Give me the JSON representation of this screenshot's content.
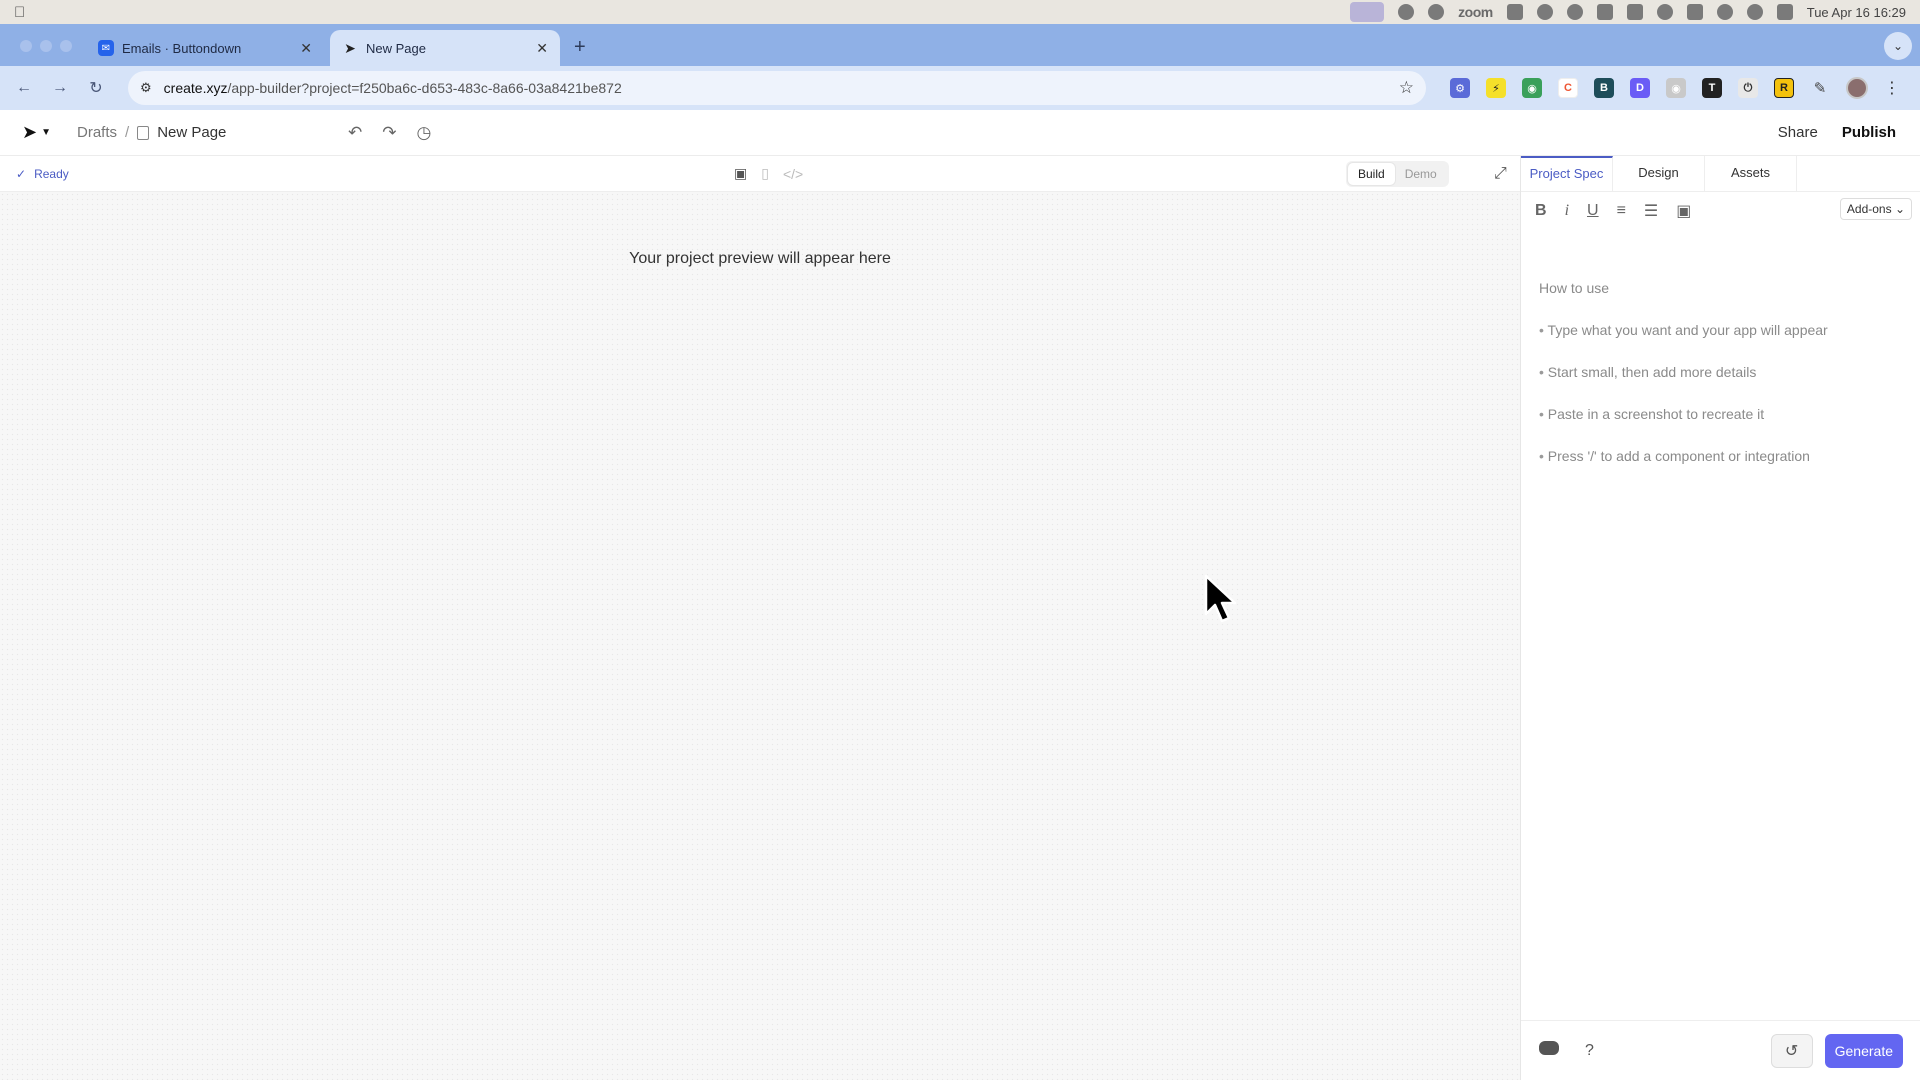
{
  "menubar": {
    "apple": "",
    "zoom_label": "zoom",
    "clock": "Tue Apr 16  16:29"
  },
  "browser": {
    "tabs": [
      {
        "title": "Emails · Buttondown",
        "favicon": "buttondown-icon"
      },
      {
        "title": "New Page",
        "favicon": "create-logo-icon"
      }
    ],
    "new_tab": "+",
    "url_host": "create.xyz",
    "url_path": "/app-builder?project=f250ba6c-d653-483c-8a66-03a8421be872"
  },
  "header": {
    "drafts": "Drafts",
    "sep": "/",
    "page_name": "New Page",
    "share": "Share",
    "publish": "Publish"
  },
  "subbar": {
    "status": "Ready",
    "build": "Build",
    "demo": "Demo"
  },
  "preview": {
    "message": "Your project preview will appear here"
  },
  "panel": {
    "tabs": [
      "Project Spec",
      "Design",
      "Assets"
    ],
    "addons": "Add-ons",
    "howto_title": "How to use",
    "howto_items": [
      "Type what you want and your app will appear",
      "Start small, then add more details",
      "Paste in a screenshot to recreate it",
      "Press '/' to add a component or integration"
    ],
    "help": "?",
    "generate": "Generate"
  },
  "colors": {
    "accent": "#4b5cc4",
    "generate_bg": "#6366f1",
    "tabstrip": "#8fb0e6"
  }
}
